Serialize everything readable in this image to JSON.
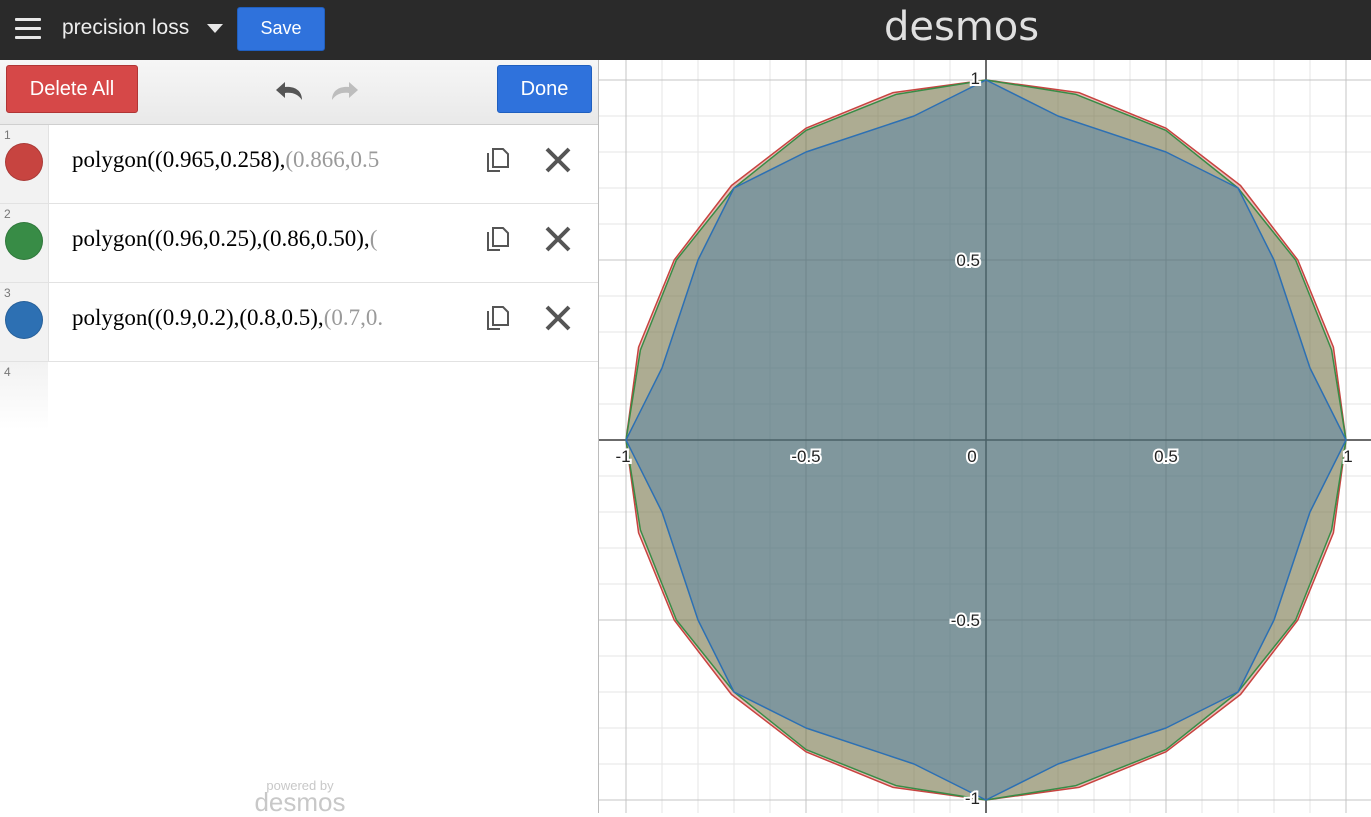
{
  "header": {
    "menu_icon": "hamburger-menu-icon",
    "graph_title": "precision loss",
    "save_label": "Save",
    "brand": "desmos"
  },
  "toolbar": {
    "delete_all_label": "Delete All",
    "undo_icon": "undo-arrow-icon",
    "redo_icon": "redo-arrow-icon",
    "done_label": "Done"
  },
  "expressions": [
    {
      "index": "1",
      "color": "#c74440",
      "visible_text": "polygon((0.965,0.258),(0.866,0.5",
      "fade_tail": "(0.866,0.5"
    },
    {
      "index": "2",
      "color": "#388c46",
      "visible_text": "polygon((0.96,0.25),(0.86,0.50),(",
      "fade_tail": "("
    },
    {
      "index": "3",
      "color": "#2d70b3",
      "visible_text": "polygon((0.9,0.2),(0.8,0.5),(0.7,0.",
      "fade_tail": "(0.7,0."
    }
  ],
  "empty_row_index": "4",
  "footer": {
    "powered_by": "powered by",
    "brand": "desmos"
  },
  "chart_data": {
    "type": "area",
    "xlim": [
      -1.07,
      1.07
    ],
    "ylim": [
      -1.0,
      1.0
    ],
    "grid": true,
    "x_ticks": [
      -1,
      -0.5,
      0,
      0.5,
      1
    ],
    "y_ticks": [
      -1,
      -0.5,
      0.5,
      1
    ],
    "tick_labels_x": [
      "-1",
      "-0.5",
      "0",
      "0.5",
      "1"
    ],
    "tick_labels_y": [
      "-1",
      "-0.5",
      "0.5",
      "1"
    ],
    "series": [
      {
        "color": "#c74440",
        "points": [
          [
            0.965,
            0.258
          ],
          [
            0.866,
            0.5
          ],
          [
            0.707,
            0.707
          ],
          [
            0.5,
            0.866
          ],
          [
            0.258,
            0.965
          ],
          [
            0,
            1
          ],
          [
            -0.258,
            0.965
          ],
          [
            -0.5,
            0.866
          ],
          [
            -0.707,
            0.707
          ],
          [
            -0.866,
            0.5
          ],
          [
            -0.965,
            0.258
          ],
          [
            -1,
            0
          ],
          [
            -0.965,
            -0.258
          ],
          [
            -0.866,
            -0.5
          ],
          [
            -0.707,
            -0.707
          ],
          [
            -0.5,
            -0.866
          ],
          [
            -0.258,
            -0.965
          ],
          [
            0,
            -1
          ],
          [
            0.258,
            -0.965
          ],
          [
            0.5,
            -0.866
          ],
          [
            0.707,
            -0.707
          ],
          [
            0.866,
            -0.5
          ],
          [
            0.965,
            -0.258
          ],
          [
            1,
            0
          ]
        ]
      },
      {
        "color": "#388c46",
        "points": [
          [
            0.96,
            0.25
          ],
          [
            0.86,
            0.5
          ],
          [
            0.7,
            0.7
          ],
          [
            0.5,
            0.86
          ],
          [
            0.25,
            0.96
          ],
          [
            0,
            1
          ],
          [
            -0.25,
            0.96
          ],
          [
            -0.5,
            0.86
          ],
          [
            -0.7,
            0.7
          ],
          [
            -0.86,
            0.5
          ],
          [
            -0.96,
            0.25
          ],
          [
            -1,
            0
          ],
          [
            -0.96,
            -0.25
          ],
          [
            -0.86,
            -0.5
          ],
          [
            -0.7,
            -0.7
          ],
          [
            -0.5,
            -0.86
          ],
          [
            -0.25,
            -0.96
          ],
          [
            0,
            -1
          ],
          [
            0.25,
            -0.96
          ],
          [
            0.5,
            -0.86
          ],
          [
            0.7,
            -0.7
          ],
          [
            0.86,
            -0.5
          ],
          [
            0.96,
            -0.25
          ],
          [
            1,
            0
          ]
        ]
      },
      {
        "color": "#2d70b3",
        "points": [
          [
            0.9,
            0.2
          ],
          [
            0.8,
            0.5
          ],
          [
            0.7,
            0.7
          ],
          [
            0.5,
            0.8
          ],
          [
            0.2,
            0.9
          ],
          [
            0,
            1
          ],
          [
            -0.2,
            0.9
          ],
          [
            -0.5,
            0.8
          ],
          [
            -0.7,
            0.7
          ],
          [
            -0.8,
            0.5
          ],
          [
            -0.9,
            0.2
          ],
          [
            -1,
            0
          ],
          [
            -0.9,
            -0.2
          ],
          [
            -0.8,
            -0.5
          ],
          [
            -0.7,
            -0.7
          ],
          [
            -0.5,
            -0.8
          ],
          [
            -0.2,
            -0.9
          ],
          [
            0,
            -1
          ],
          [
            0.2,
            -0.9
          ],
          [
            0.5,
            -0.8
          ],
          [
            0.7,
            -0.7
          ],
          [
            0.8,
            -0.5
          ],
          [
            0.9,
            -0.2
          ],
          [
            1,
            0
          ]
        ]
      }
    ]
  }
}
